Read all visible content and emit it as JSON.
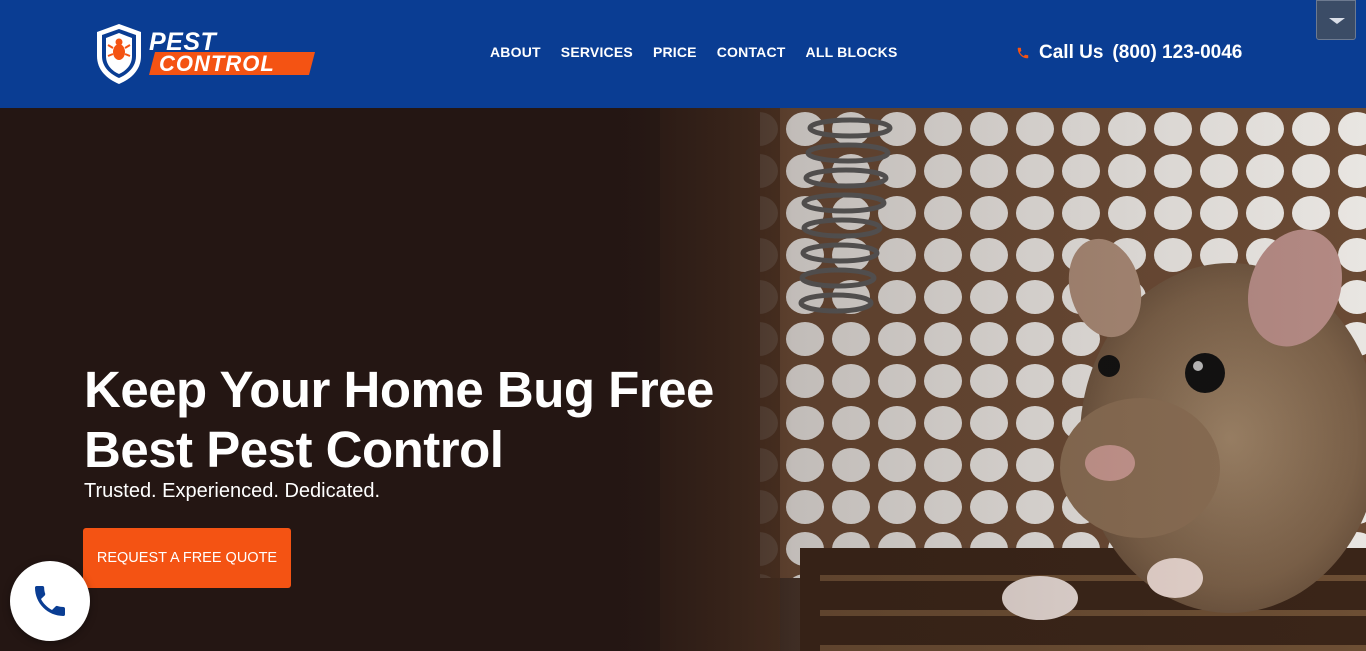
{
  "header": {
    "brand": {
      "line1": "PEST",
      "line2": "CONTROL"
    },
    "nav": [
      {
        "label": "ABOUT"
      },
      {
        "label": "SERVICES"
      },
      {
        "label": "PRICE"
      },
      {
        "label": "CONTACT"
      },
      {
        "label": "ALL BLOCKS"
      }
    ],
    "call_label": "Call Us",
    "phone": "(800) 123-0046",
    "dropdown_icon": "caret-down-icon"
  },
  "hero": {
    "headline_line1": "Keep Your Home Bug Free",
    "headline_line2": "Best Pest Control",
    "tagline": "Trusted. Experienced. Dedicated.",
    "cta_label": "REQUEST A FREE QUOTE",
    "image": "rat-in-cage"
  },
  "floating_call_icon": "phone-icon",
  "colors": {
    "header_bg": "#0a3d93",
    "accent": "#f45313",
    "text": "#ffffff"
  }
}
